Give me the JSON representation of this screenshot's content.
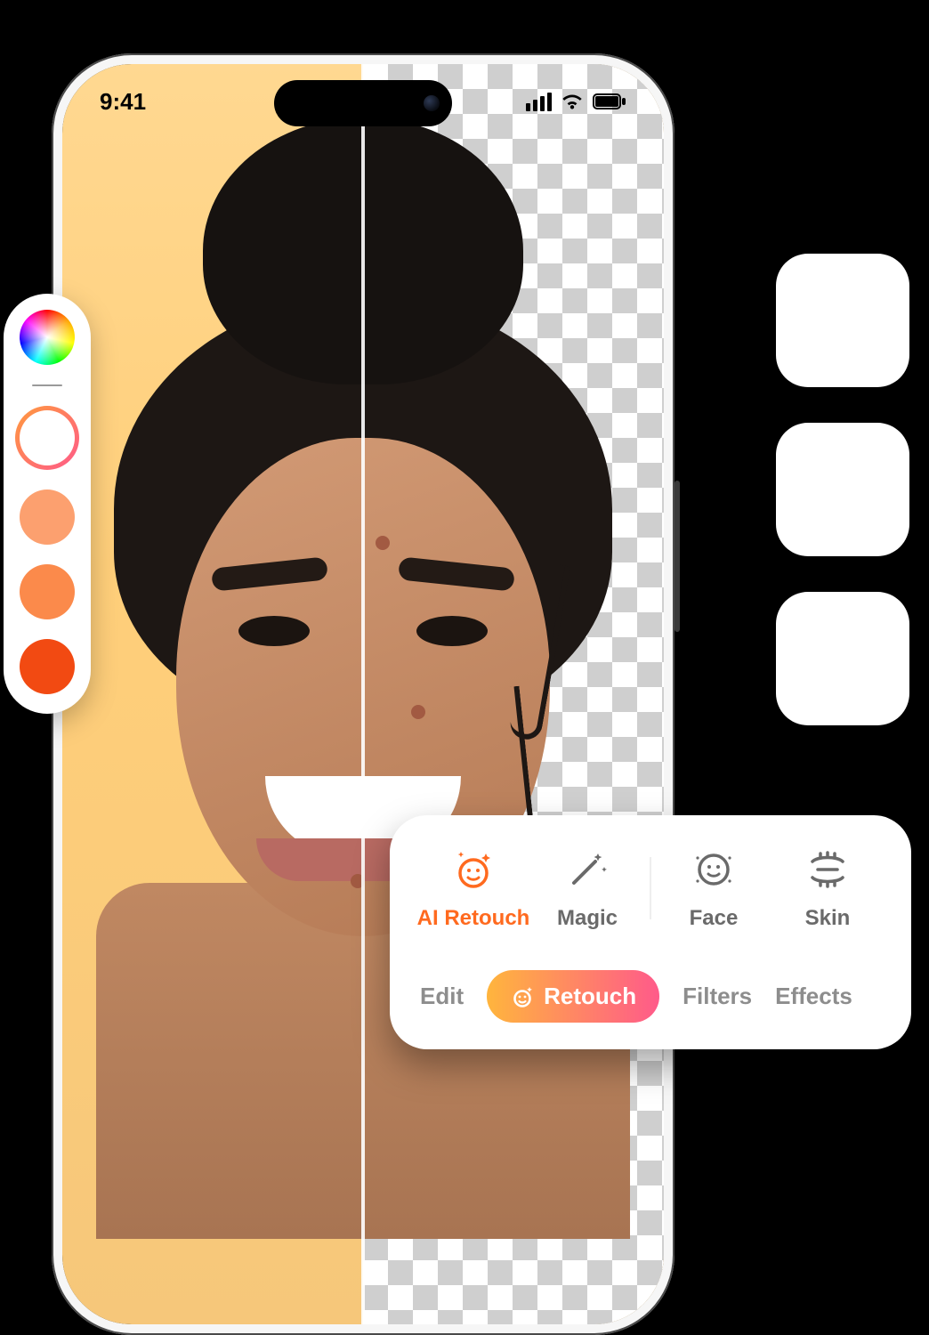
{
  "status_bar": {
    "time": "9:41"
  },
  "palette": {
    "swatches": [
      {
        "name": "color-wheel",
        "color": "conic"
      },
      {
        "name": "selected-ring",
        "color": "ring"
      },
      {
        "name": "swatch-1",
        "color": "#fca06f"
      },
      {
        "name": "swatch-2",
        "color": "#fb8a4b"
      },
      {
        "name": "swatch-3",
        "color": "#f24a12"
      }
    ]
  },
  "tools": {
    "items": [
      {
        "label": "AI Retouch",
        "icon": "ai-retouch-icon",
        "active": true
      },
      {
        "label": "Magic",
        "icon": "magic-wand-icon",
        "active": false
      },
      {
        "label": "Face",
        "icon": "face-icon",
        "active": false
      },
      {
        "label": "Skin",
        "icon": "skin-icon",
        "active": false
      }
    ]
  },
  "tabs": {
    "items": [
      {
        "label": "Edit",
        "active": false
      },
      {
        "label": "Retouch",
        "active": true
      },
      {
        "label": "Filters",
        "active": false
      },
      {
        "label": "Effects",
        "active": false
      }
    ]
  },
  "accent_color": "#ff6a1f"
}
